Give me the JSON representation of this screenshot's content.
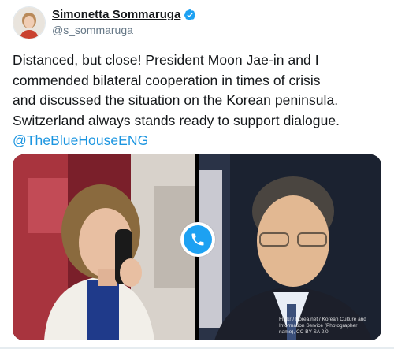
{
  "author": {
    "display_name": "Simonetta Sommaruga",
    "handle": "@s_sommaruga",
    "verified": true,
    "avatar_icon": "profile-photo-avatar"
  },
  "tweet": {
    "text_lines": [
      "Distanced, but close! President Moon Jae-in and I",
      "commended bilateral cooperation in times of crisis",
      "and discussed the situation on the Korean peninsula.",
      "Switzerland always stands ready to support dialogue."
    ],
    "mention": "@TheBlueHouseENG"
  },
  "media": {
    "call_icon": "phone-call-icon",
    "photo_credit": "Flickr / Korea.net / Korean Culture and Information Service (Photographer name), CC BY-SA 2.0,"
  },
  "colors": {
    "mention": "#1b95e0",
    "call_badge": "#1da1f2",
    "verified": "#1da1f2"
  }
}
